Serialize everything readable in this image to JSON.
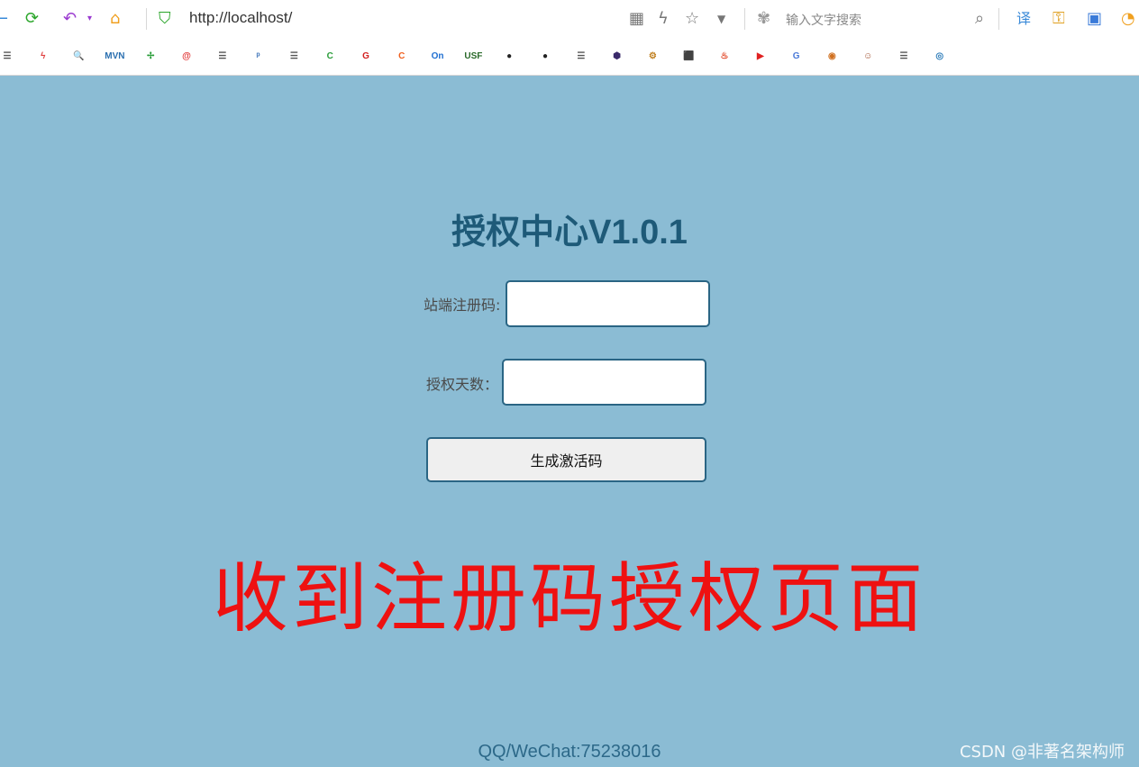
{
  "browser": {
    "url": "http://localhost/",
    "search_placeholder": "输入文字搜索",
    "bookmarks": [
      {
        "name": "doc",
        "glyph": "☰",
        "color": "#555555"
      },
      {
        "name": "bolt",
        "glyph": "ϟ",
        "color": "#e04040"
      },
      {
        "name": "search",
        "glyph": "🔍",
        "color": "#3377cc"
      },
      {
        "name": "mvn",
        "glyph": "MVN",
        "color": "#2a6fb0"
      },
      {
        "name": "pinwheel",
        "glyph": "✢",
        "color": "#2a9d3a"
      },
      {
        "name": "at",
        "glyph": "@",
        "color": "#e03030"
      },
      {
        "name": "doc",
        "glyph": "☰",
        "color": "#555555"
      },
      {
        "name": "python",
        "glyph": "ᵖ",
        "color": "#3b72b8"
      },
      {
        "name": "doc",
        "glyph": "☰",
        "color": "#555555"
      },
      {
        "name": "c-green",
        "glyph": "C",
        "color": "#2a9d3a"
      },
      {
        "name": "g-red",
        "glyph": "G",
        "color": "#d32020"
      },
      {
        "name": "c-orange",
        "glyph": "C",
        "color": "#f06020"
      },
      {
        "name": "on",
        "glyph": "On",
        "color": "#1f6fd1"
      },
      {
        "name": "usf",
        "glyph": "USF",
        "color": "#2a6a2a"
      },
      {
        "name": "github",
        "glyph": "●",
        "color": "#222222"
      },
      {
        "name": "github",
        "glyph": "●",
        "color": "#222222"
      },
      {
        "name": "doc",
        "glyph": "☰",
        "color": "#555555"
      },
      {
        "name": "hex",
        "glyph": "⬢",
        "color": "#3a2a6a"
      },
      {
        "name": "gear",
        "glyph": "⚙",
        "color": "#c08020"
      },
      {
        "name": "gift",
        "glyph": "⬛",
        "color": "#d03030"
      },
      {
        "name": "flame",
        "glyph": "♨",
        "color": "#e04020"
      },
      {
        "name": "play",
        "glyph": "▶",
        "color": "#e02020"
      },
      {
        "name": "translate",
        "glyph": "G",
        "color": "#4a7ad8"
      },
      {
        "name": "ball",
        "glyph": "◉",
        "color": "#d07020"
      },
      {
        "name": "avatar",
        "glyph": "☺",
        "color": "#a05030"
      },
      {
        "name": "doc",
        "glyph": "☰",
        "color": "#555555"
      },
      {
        "name": "eye",
        "glyph": "◎",
        "color": "#2a7ab8"
      }
    ]
  },
  "page": {
    "title": "授权中心V1.0.1",
    "reg_label": "站端注册码:",
    "reg_value": "",
    "days_label": "授权天数：",
    "days_value": "",
    "generate_button": "生成激活码",
    "banner": "收到注册码授权页面",
    "footer": "QQ/WeChat:75238016",
    "watermark": "CSDN @非著名架构师"
  }
}
